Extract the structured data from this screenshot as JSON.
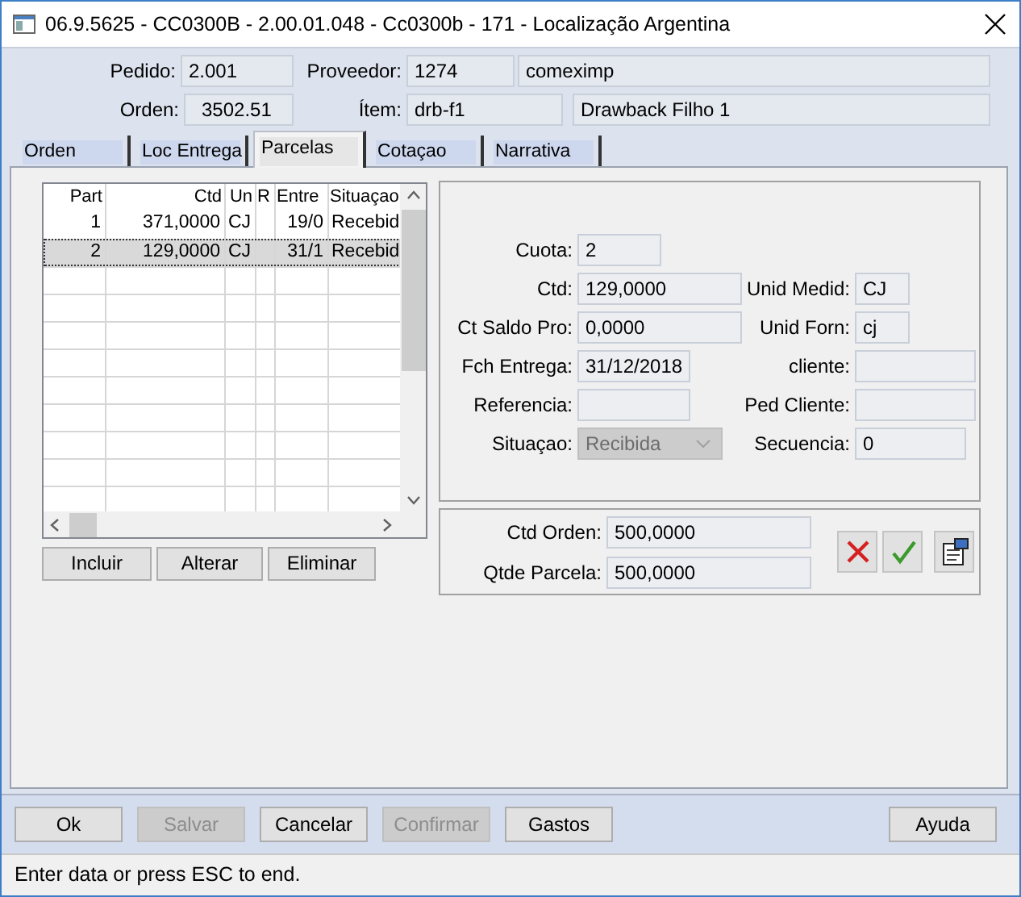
{
  "window": {
    "title": "06.9.5625 - CC0300B - 2.00.01.048 - Cc0300b - 171 - Localização Argentina"
  },
  "header": [
    {
      "label": "Pedido:",
      "values": [
        "2.001"
      ]
    },
    {
      "label": "Proveedor:",
      "values": [
        "1274",
        "comeximp"
      ]
    },
    {
      "label": "Orden:",
      "values": [
        "3502.51"
      ]
    },
    {
      "label": "Ítem:",
      "values": [
        "drb-f1",
        "Drawback Filho 1"
      ]
    }
  ],
  "tabs": [
    {
      "label": "Orden",
      "selected": false
    },
    {
      "label": "Loc Entrega",
      "selected": false
    },
    {
      "label": "Parcelas",
      "selected": true
    },
    {
      "label": "Cotaçao",
      "selected": false
    },
    {
      "label": "Narrativa",
      "selected": false
    }
  ],
  "table": {
    "columns": [
      "Part",
      "Ctd",
      "Un",
      "R",
      "Entre",
      "Situaçao"
    ],
    "rows": [
      {
        "cells": [
          "1",
          "371,0000",
          "CJ",
          "",
          "19/0",
          "Recebid"
        ],
        "selected": false
      },
      {
        "cells": [
          "2",
          "129,0000",
          "CJ",
          "",
          "31/1",
          "Recebid"
        ],
        "selected": true
      }
    ]
  },
  "table_buttons": [
    "Incluir",
    "Alterar",
    "Eliminar"
  ],
  "detail": [
    {
      "left": {
        "label": "Cuota:",
        "value": "2"
      }
    },
    {
      "left": {
        "label": "Ctd:",
        "value": "129,0000"
      },
      "right": {
        "label": "Unid Medid:",
        "value": "CJ"
      }
    },
    {
      "left": {
        "label": "Ct Saldo Pro:",
        "value": "0,0000"
      },
      "right": {
        "label": "Unid Forn:",
        "value": "cj"
      }
    },
    {
      "left": {
        "label": "Fch Entrega:",
        "value": "31/12/2018"
      },
      "right": {
        "label": "cliente:"
      }
    },
    {
      "left": {
        "label": "Referencia:"
      },
      "right": {
        "label": "Ped Cliente:"
      }
    },
    {
      "left": {
        "label": "Situaçao:",
        "value": "Recibida",
        "kind": "select",
        "disabled": true
      },
      "right": {
        "label": "Secuencia:",
        "value": "0"
      }
    }
  ],
  "totals": [
    {
      "label": "Ctd Orden:",
      "value": "500,0000"
    },
    {
      "label": "Qtde Parcela:",
      "value": "500,0000"
    }
  ],
  "actions": [
    {
      "kind": "cancel"
    },
    {
      "kind": "confirm"
    },
    {
      "kind": "properties"
    }
  ],
  "buttons": [
    {
      "label": "Ok",
      "disabled": false
    },
    {
      "label": "Salvar",
      "disabled": true
    },
    {
      "label": "Cancelar",
      "disabled": false
    },
    {
      "label": "Confirmar",
      "disabled": true
    },
    {
      "label": "Gastos",
      "disabled": false
    },
    {
      "label": "Ayuda",
      "disabled": false
    }
  ],
  "status_bar": "Enter data or press ESC to end."
}
